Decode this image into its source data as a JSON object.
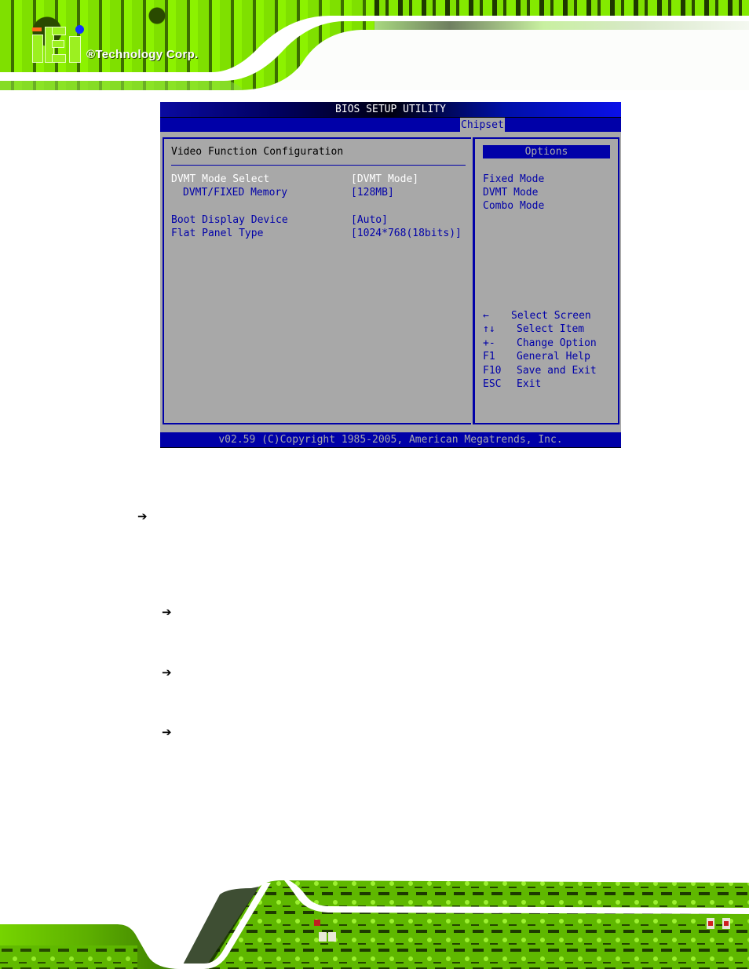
{
  "header": {
    "logo_mark": "iEi",
    "logo_text": "®Technology Corp."
  },
  "bios": {
    "title": "BIOS SETUP UTILITY",
    "active_tab": "Chipset",
    "section_title": "Video Function Configuration",
    "items": [
      {
        "label": "DVMT Mode Select",
        "value": "[DVMT Mode]",
        "selected": true,
        "indent": false
      },
      {
        "label": "DVMT/FIXED Memory",
        "value": "[128MB]",
        "selected": false,
        "indent": true
      },
      {
        "label": "Boot Display Device",
        "value": "[Auto]",
        "selected": false,
        "indent": false
      },
      {
        "label": "Flat Panel Type",
        "value": "[1024*768(18bits)]",
        "selected": false,
        "indent": false
      }
    ],
    "options_header": "Options",
    "options": [
      "Fixed Mode",
      "DVMT Mode",
      "Combo Mode"
    ],
    "help": [
      {
        "key": "←",
        "desc": "Select Screen"
      },
      {
        "key": "↑↓",
        "desc": "Select Item"
      },
      {
        "key": "+-",
        "desc": "Change Option"
      },
      {
        "key": "F1",
        "desc": "General Help"
      },
      {
        "key": "F10",
        "desc": "Save and Exit"
      },
      {
        "key": "ESC",
        "desc": "Exit"
      }
    ],
    "footer": "v02.59 (C)Copyright 1985-2005, American Megatrends, Inc."
  },
  "document": {
    "arrows": [
      "➔",
      "➔",
      "➔",
      "➔"
    ]
  },
  "colors": {
    "bios_blue": "#0000a8",
    "bios_gray": "#a8a8a8",
    "pcb_green": "#7fe000"
  }
}
